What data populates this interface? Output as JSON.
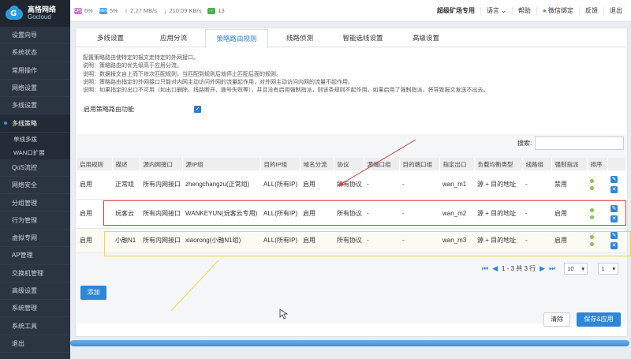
{
  "app": {
    "brand_cn": "高恪网络",
    "brand_en": "Gocloud"
  },
  "sidebar": {
    "items": [
      {
        "label": "设置向导"
      },
      {
        "label": "系统状态"
      },
      {
        "label": "常用操作"
      },
      {
        "label": "网络设置"
      },
      {
        "label": "多线设置"
      }
    ],
    "active": {
      "label": "多线策略"
    },
    "sub": [
      {
        "label": "单线多拨"
      },
      {
        "label": "WAN口扩展"
      }
    ],
    "rest": [
      {
        "label": "QoS流控"
      },
      {
        "label": "网络安全"
      },
      {
        "label": "分组管理"
      },
      {
        "label": "行为管理"
      },
      {
        "label": "虚拟专网"
      },
      {
        "label": "AP管理"
      },
      {
        "label": "交换机管理"
      },
      {
        "label": "高级设置"
      },
      {
        "label": "系统管理"
      },
      {
        "label": "系统工具"
      },
      {
        "label": "退出"
      }
    ]
  },
  "topbar": {
    "cpu_label": "CPU",
    "cpu": "6%",
    "mem_label": "MEM",
    "mem": "5%",
    "up": "2.27 MB/s",
    "down": "210.09 KB/s",
    "sessions": "13",
    "links": [
      "超级矿场专用",
      "语言",
      "帮助",
      "微信绑定",
      "反馈",
      "退出"
    ]
  },
  "tabs": [
    {
      "label": "多线设置"
    },
    {
      "label": "应用分流"
    },
    {
      "label": "策略路由规则"
    },
    {
      "label": "线路侦测"
    },
    {
      "label": "智能选线设置"
    },
    {
      "label": "高级设置"
    }
  ],
  "description": [
    "配置策略路由使特定的报文走特定的外网接口。",
    "说明：策略路由的优先级高于应用分流。",
    "说明：数据报文自上而下依次匹配规则，当匹配到规则后就停止匹配后面的规则。",
    "说明：策略路由指定的外网接口只能对内网主动访问外网的流量起作用，对外网主动访问内网的流量不起作用。",
    "说明：如果指定的出口不可用（如出口删除、线路断开、拨号失败等），并且没有启用强制指派，则该条规则不起作用。如果启用了强制指派，将导致报文发送不出去。"
  ],
  "enable_label": "启用策略路由功能",
  "enable_check": "✓",
  "search_label": "搜索:",
  "table": {
    "headers": [
      "启用规则",
      "描述",
      "源内网接口",
      "源IP组",
      "目的IP组",
      "域名分流",
      "协议",
      "源端口组",
      "目的端口组",
      "指定出口",
      "负载均衡类型",
      "线路组",
      "强制指派",
      "排序",
      ""
    ],
    "rows": [
      {
        "enable": "启用",
        "desc": "正常组",
        "iface": "所有内网接口",
        "srcip": "zhengchangzu(正常组)",
        "dstip": "ALL(所有IP)",
        "domain": "启用",
        "proto": "所有协议",
        "sport": "-",
        "dport": "-",
        "out": "wan_m1",
        "lb": "源 + 目的地址",
        "group": "-",
        "force": "禁用"
      },
      {
        "enable": "启用",
        "desc": "玩客云",
        "iface": "所有内网接口",
        "srcip": "WANKEYUN(玩客云专用)",
        "dstip": "ALL(所有IP)",
        "domain": "启用",
        "proto": "所有协议",
        "sport": "-",
        "dport": "-",
        "out": "wan_m2",
        "lb": "源 + 目的地址",
        "group": "-",
        "force": "启用"
      },
      {
        "enable": "启用",
        "desc": "小融N1",
        "iface": "所有内网接口",
        "srcip": "xiaorong(小融N1组)",
        "dstip": "ALL(所有IP)",
        "domain": "启用",
        "proto": "所有协议",
        "sport": "-",
        "dport": "-",
        "out": "wan_m3",
        "lb": "源 + 目的地址",
        "group": "-",
        "force": "启用"
      }
    ]
  },
  "pager": {
    "info": "1 - 3 共 3 行",
    "page_size": "10",
    "page": "1"
  },
  "buttons": {
    "add": "添加",
    "clear": "清除",
    "save": "保存&应用"
  },
  "progress": {
    "value": 1.0
  },
  "colors": {
    "accent": "#2d86d6",
    "sidebar": "#2b3441",
    "red_annotation": "#d23c3c",
    "yellow_annotation": "#f0d34a"
  }
}
